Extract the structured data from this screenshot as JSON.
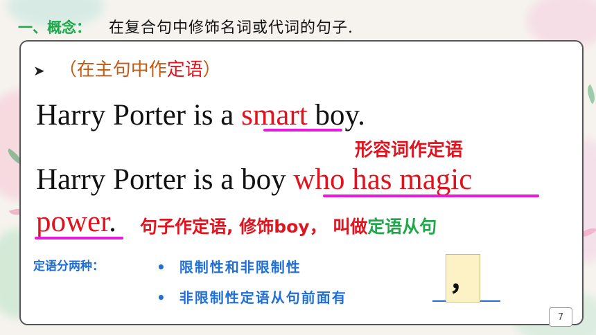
{
  "heading": {
    "label": "一、概念：",
    "text": "在复合句中修饰名词或代词的句子."
  },
  "subtitle": {
    "prefix": "（在主句中作",
    "highlight": "定语",
    "suffix": "）"
  },
  "sentence1": {
    "before": "Harry Porter is a ",
    "highlight": "smart",
    "after": " boy."
  },
  "note1": "形容词作定语",
  "sentence2": {
    "before": "Harry Porter is a boy ",
    "highlight_line1": "who has magic",
    "highlight_line2": "power",
    "after": "."
  },
  "note2": {
    "part1": "句子作定语, 修饰boy， 叫做",
    "highlight": "定语从句"
  },
  "kinds": {
    "label": "定语分两种：",
    "bullet_symbol": "•",
    "item1": "限制性和非限制性",
    "item2": "非限制性定语从句前面有"
  },
  "answer": "，",
  "page_number": "7",
  "colors": {
    "green": "#1fa84a",
    "red": "#e0141e",
    "blue": "#1f6fd6",
    "magenta": "#e81ae0",
    "brown": "#c55a11"
  }
}
